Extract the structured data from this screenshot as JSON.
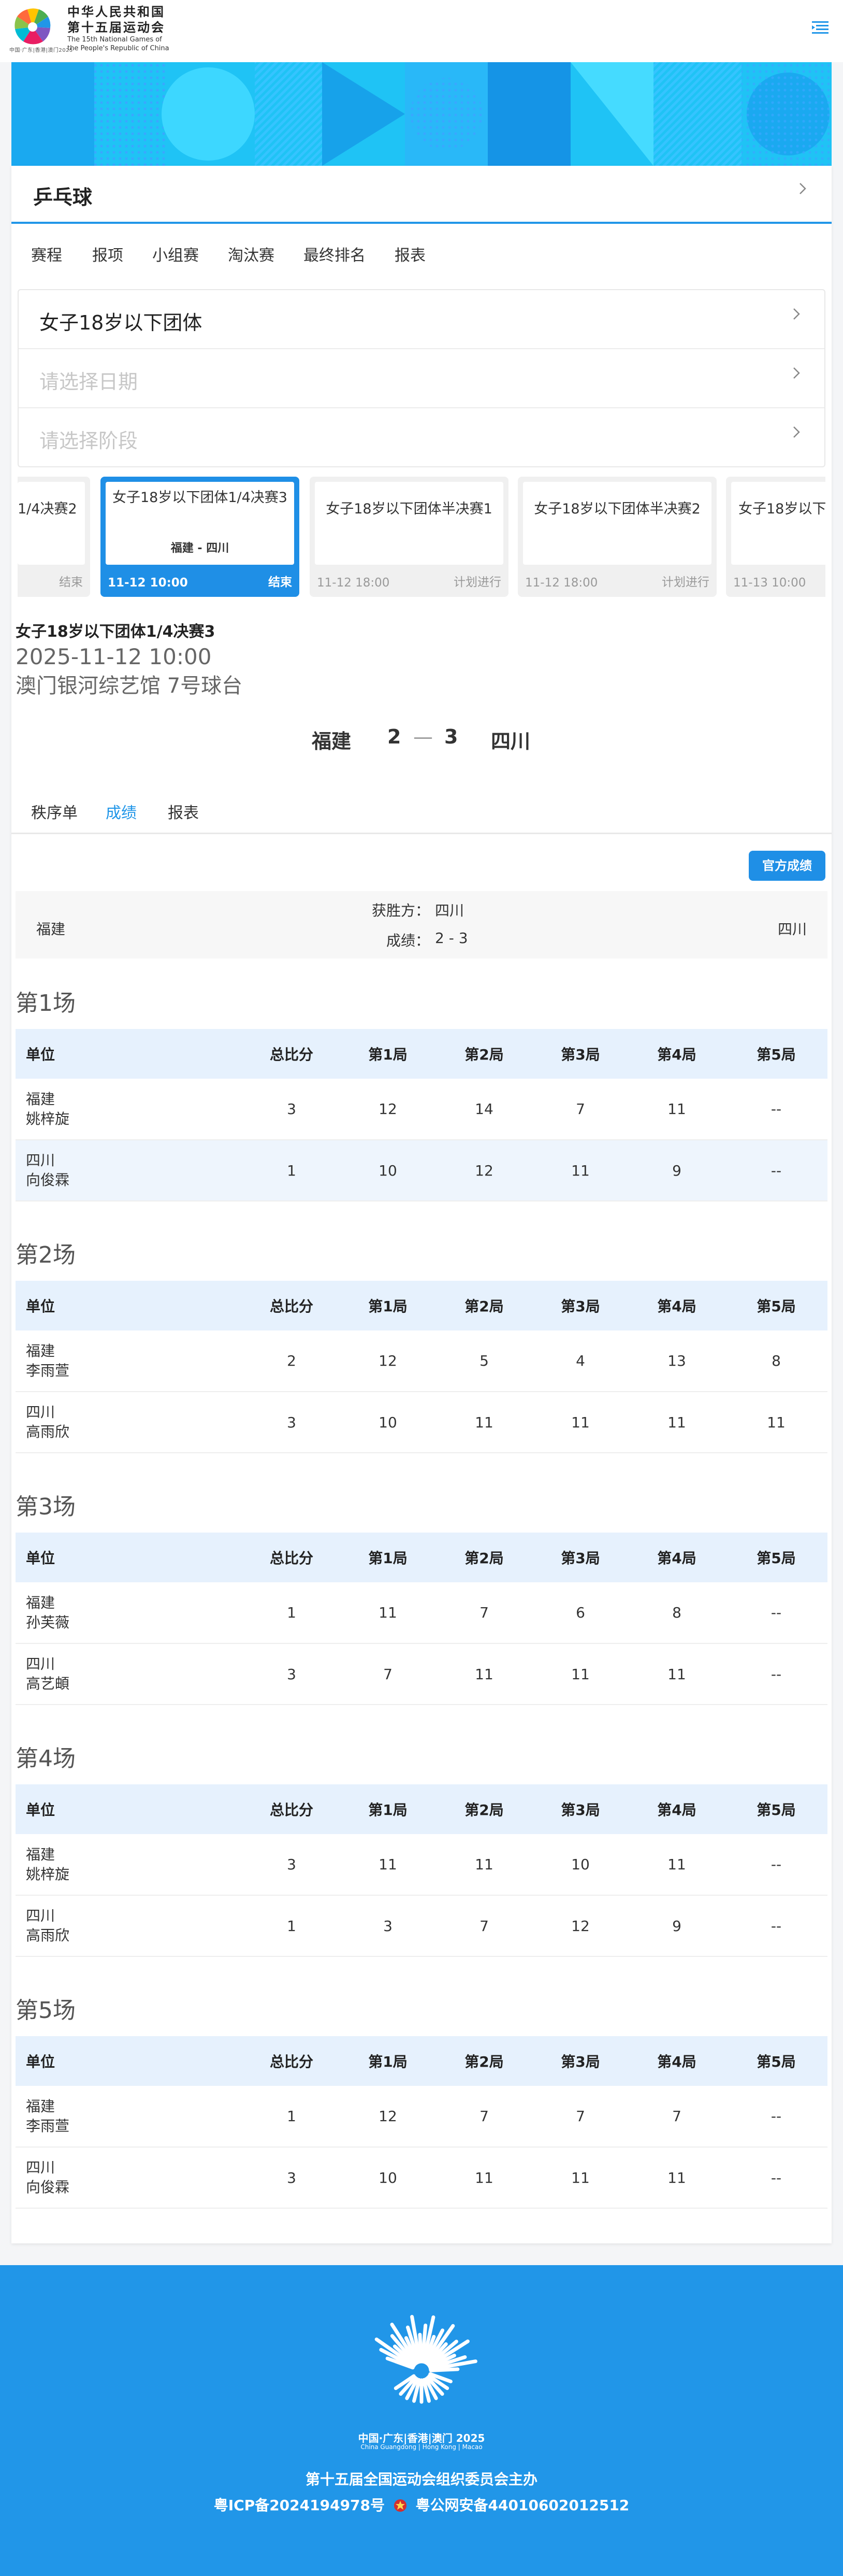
{
  "header": {
    "org_cn": "中华人民共和国",
    "games_cn": "第十五届运动会",
    "games_en_1": "The 15th National Games of",
    "games_en_2": "the People's Republic of China",
    "logo_sub": "中国·广东|香港|澳门2025"
  },
  "sport": {
    "title": "乒乓球"
  },
  "tabs": [
    {
      "label": "赛程"
    },
    {
      "label": "报项"
    },
    {
      "label": "小组赛"
    },
    {
      "label": "淘汰赛"
    },
    {
      "label": "最终排名"
    },
    {
      "label": "报表"
    }
  ],
  "selectors": {
    "event": "女子18岁以下团体",
    "date_placeholder": "请选择日期",
    "stage_placeholder": "请选择阶段"
  },
  "match_cards": [
    {
      "name": "1/4决赛2",
      "teams": "",
      "time": "",
      "status": "结束"
    },
    {
      "name": "女子18岁以下团体1/4决赛3",
      "teams": "福建 - 四川",
      "time": "11-12 10:00",
      "status": "结束"
    },
    {
      "name": "女子18岁以下团体半决赛1",
      "teams": "",
      "time": "11-12 18:00",
      "status": "计划进行"
    },
    {
      "name": "女子18岁以下团体半决赛2",
      "teams": "",
      "time": "11-12 18:00",
      "status": "计划进行"
    },
    {
      "name": "女子18岁以下团",
      "teams": "",
      "time": "11-13 10:00",
      "status": ""
    }
  ],
  "match": {
    "name": "女子18岁以下团体1/4决赛3",
    "datetime": "2025-11-12 10:00",
    "venue": "澳门银河综艺馆 7号球台",
    "team_a": "福建",
    "score_a": "2",
    "dash": "—",
    "score_b": "3",
    "team_b": "四川"
  },
  "subtabs": [
    {
      "label": "秩序单"
    },
    {
      "label": "成绩"
    },
    {
      "label": "报表"
    }
  ],
  "official_button": "官方成绩",
  "summary": {
    "team_a": "福建",
    "team_b": "四川",
    "winner_label": "获胜方：",
    "winner": "四川",
    "score_label": "成绩：",
    "score": "2 - 3"
  },
  "table_headers": [
    "单位",
    "总比分",
    "第1局",
    "第2局",
    "第3局",
    "第4局",
    "第5局"
  ],
  "games": [
    {
      "title": "第1场",
      "rows": [
        {
          "team": "福建",
          "player": "姚梓旋",
          "total": "3",
          "g": [
            "12",
            "14",
            "7",
            "11",
            "--"
          ]
        },
        {
          "team": "四川",
          "player": "向俊霖",
          "total": "1",
          "g": [
            "10",
            "12",
            "11",
            "9",
            "--"
          ]
        }
      ]
    },
    {
      "title": "第2场",
      "rows": [
        {
          "team": "福建",
          "player": "李雨萱",
          "total": "2",
          "g": [
            "12",
            "5",
            "4",
            "13",
            "8"
          ]
        },
        {
          "team": "四川",
          "player": "高雨欣",
          "total": "3",
          "g": [
            "10",
            "11",
            "11",
            "11",
            "11"
          ]
        }
      ]
    },
    {
      "title": "第3场",
      "rows": [
        {
          "team": "福建",
          "player": "孙芙薇",
          "total": "1",
          "g": [
            "11",
            "7",
            "6",
            "8",
            "--"
          ]
        },
        {
          "team": "四川",
          "player": "高艺頔",
          "total": "3",
          "g": [
            "7",
            "11",
            "11",
            "11",
            "--"
          ]
        }
      ]
    },
    {
      "title": "第4场",
      "rows": [
        {
          "team": "福建",
          "player": "姚梓旋",
          "total": "3",
          "g": [
            "11",
            "11",
            "10",
            "11",
            "--"
          ]
        },
        {
          "team": "四川",
          "player": "高雨欣",
          "total": "1",
          "g": [
            "3",
            "7",
            "12",
            "9",
            "--"
          ]
        }
      ]
    },
    {
      "title": "第5场",
      "rows": [
        {
          "team": "福建",
          "player": "李雨萱",
          "total": "1",
          "g": [
            "12",
            "7",
            "7",
            "7",
            "--"
          ]
        },
        {
          "team": "四川",
          "player": "向俊霖",
          "total": "3",
          "g": [
            "10",
            "11",
            "11",
            "11",
            "--"
          ]
        }
      ]
    }
  ],
  "footer": {
    "logo_text": "中国·广东|香港|澳门 2025",
    "logo_en": "China Guangdong | Hong Kong | Macao",
    "line1": "第十五届全国运动会组织委员会主办",
    "icp": "粤ICP备2024194978号",
    "police": "粤公网安备44010602012512"
  },
  "colors": {
    "accent": "#2196e8",
    "button": "#1f8fe6",
    "table_header_bg": "#e6f1fd",
    "footer_bg": "#2196e8"
  },
  "icons": {
    "menu": "menu-icon",
    "chevron": "chevron-right-icon",
    "police": "police-badge-icon"
  }
}
